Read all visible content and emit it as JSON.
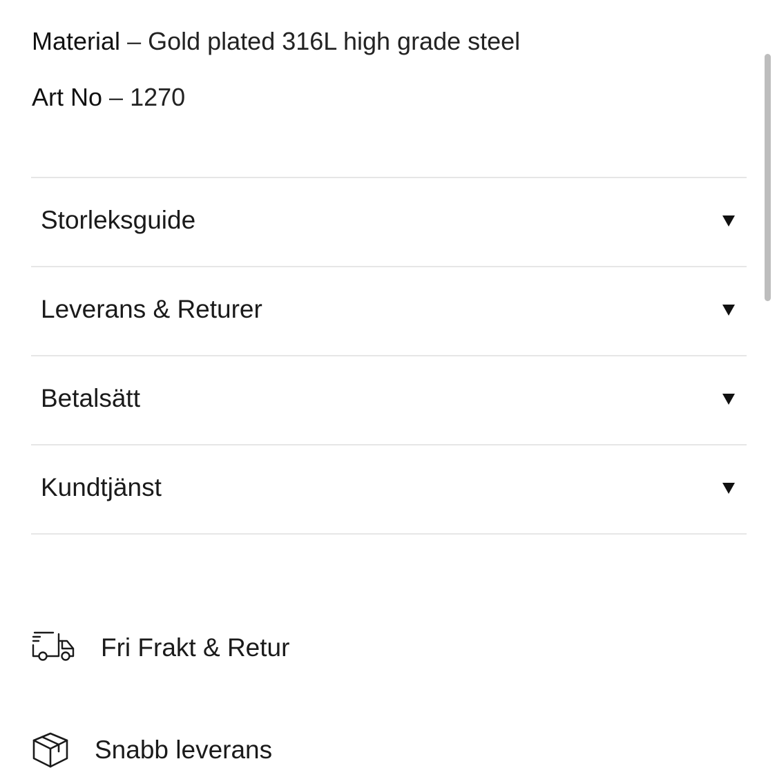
{
  "specs": {
    "material": {
      "key": "Material",
      "separator": "–",
      "value": "Gold plated 316L high grade steel"
    },
    "art_no": {
      "key": "Art No",
      "separator": "–",
      "value": "1270"
    }
  },
  "accordion": {
    "items": [
      {
        "label": "Storleksguide",
        "icon": "caret-down-icon"
      },
      {
        "label": "Leverans & Returer",
        "icon": "caret-down-icon"
      },
      {
        "label": "Betalsätt",
        "icon": "caret-down-icon"
      },
      {
        "label": "Kundtjänst",
        "icon": "caret-down-icon"
      }
    ]
  },
  "features": [
    {
      "label": "Fri Frakt & Retur",
      "icon": "delivery-truck-icon"
    },
    {
      "label": "Snabb leverans",
      "icon": "package-box-icon"
    }
  ],
  "colors": {
    "text": "#1a1a1a",
    "divider": "#e6e6e6",
    "scrollbar": "#bdbdbd"
  }
}
